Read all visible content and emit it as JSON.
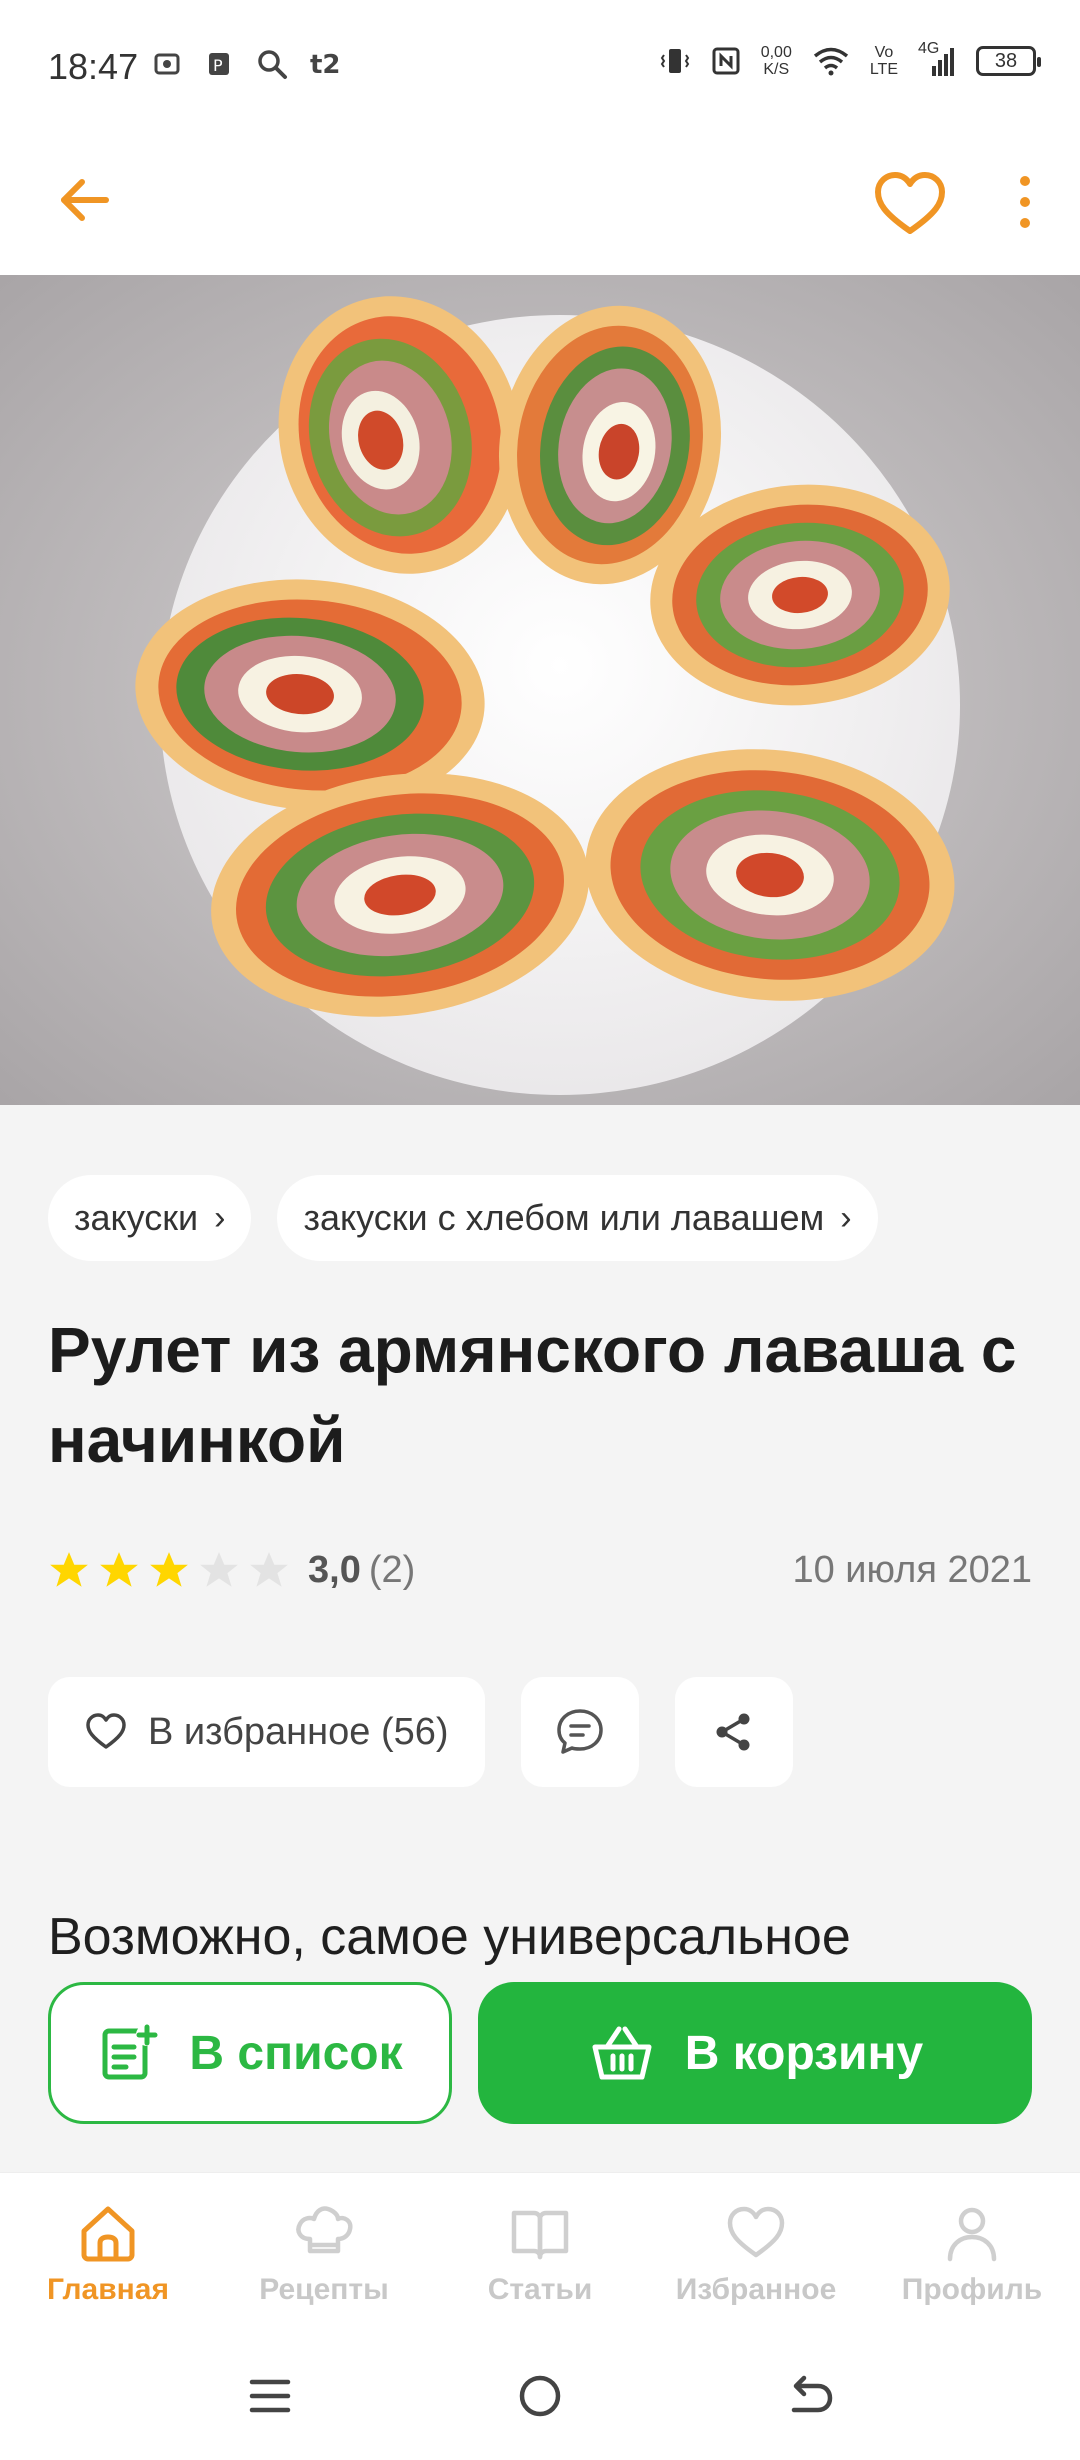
{
  "status_bar": {
    "time": "18:47",
    "net_speed_value": "0,00",
    "net_speed_unit": "K/S",
    "volte_top": "Vo",
    "volte_bottom": "LTE",
    "network_label": "4G",
    "battery_level": "38",
    "left_icons": [
      "screenshot-icon",
      "parking-icon",
      "search-icon",
      "t2-icon"
    ]
  },
  "app_bar": {
    "back_icon": "arrow-left-icon",
    "favorite_icon": "heart-icon",
    "more_icon": "more-vertical-icon",
    "accent_color": "#f09524"
  },
  "recipe": {
    "chips": [
      {
        "label": "закуски"
      },
      {
        "label": "закуски с хлебом или лавашем"
      }
    ],
    "title": "Рулет из армянского лаваша с начинкой",
    "rating": {
      "stars_filled": 3,
      "stars_total": 5,
      "value": "3,0",
      "count": "(2)"
    },
    "date": "10 июля 2021",
    "actions": {
      "favorite_label": "В избранное (56)",
      "comments_icon": "comment-icon",
      "share_icon": "share-icon"
    },
    "description": "Возможно, самое универсальное"
  },
  "cta": {
    "list_label": "В список",
    "cart_label": "В корзину",
    "green": "#23b53e"
  },
  "bottom_nav": {
    "items": [
      {
        "label": "Главная",
        "icon": "home-icon",
        "active": true
      },
      {
        "label": "Рецепты",
        "icon": "chef-hat-icon",
        "active": false
      },
      {
        "label": "Статьи",
        "icon": "book-icon",
        "active": false
      },
      {
        "label": "Избранное",
        "icon": "heart-icon",
        "active": false
      },
      {
        "label": "Профиль",
        "icon": "person-icon",
        "active": false
      }
    ]
  }
}
